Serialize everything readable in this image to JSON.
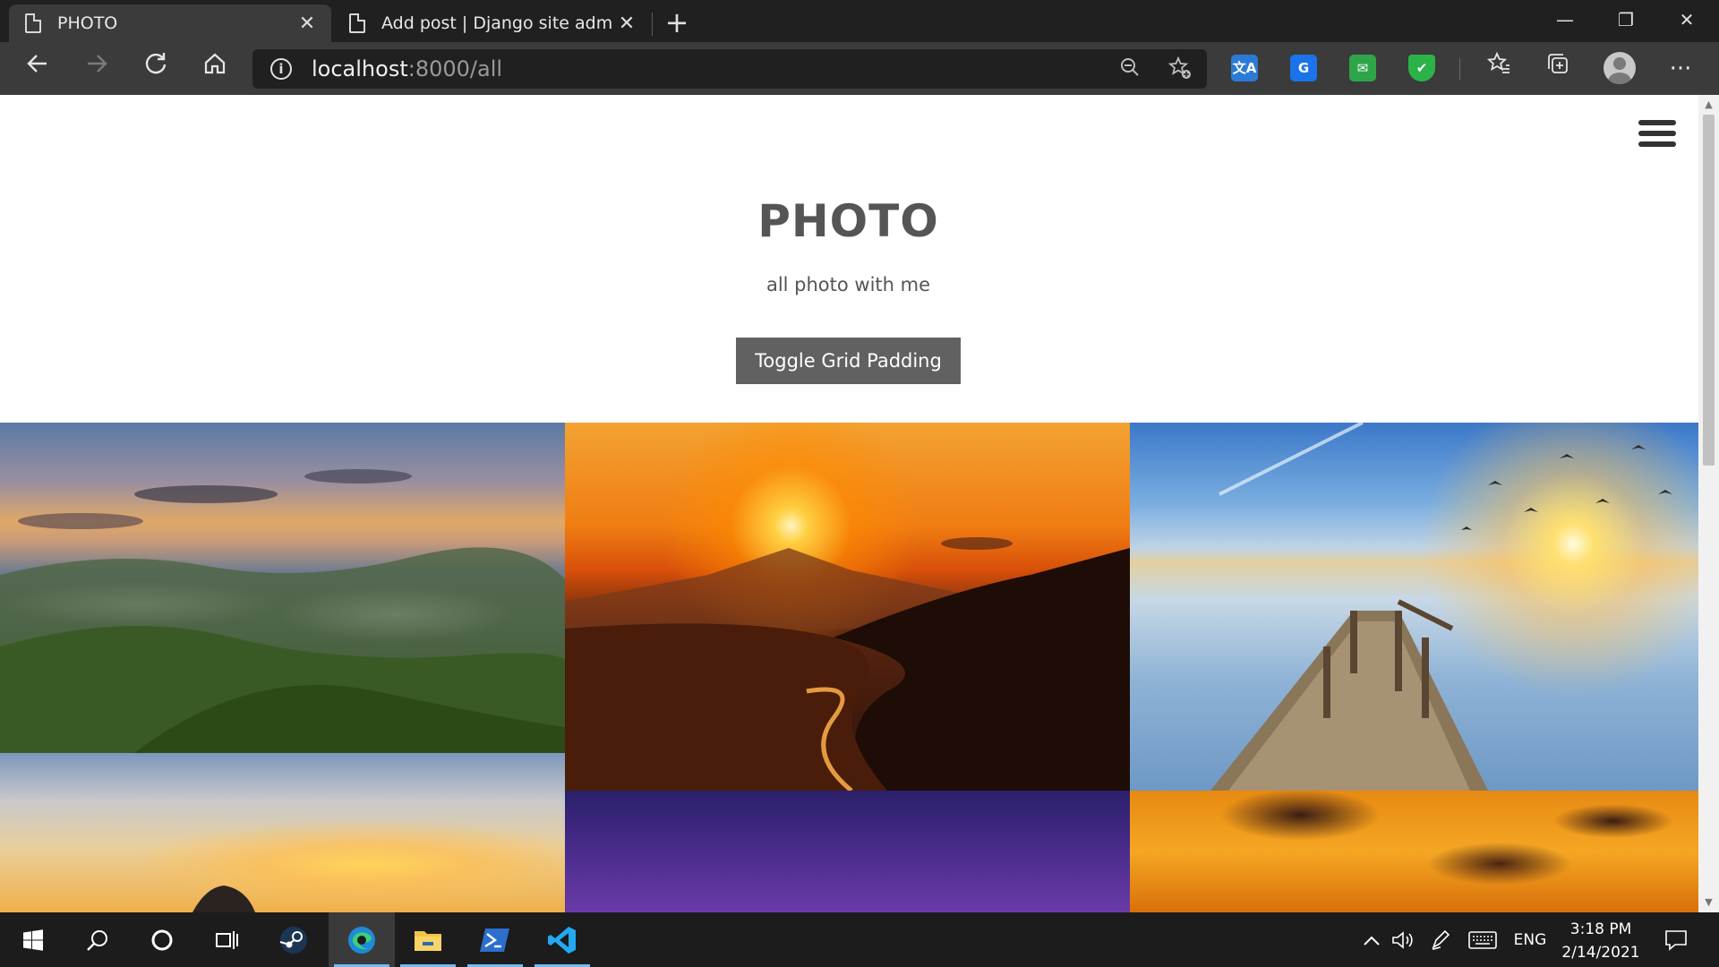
{
  "browser": {
    "tabs": [
      {
        "title": "PHOTO",
        "active": true
      },
      {
        "title": "Add post | Django site admin",
        "active": false
      }
    ],
    "new_tab_glyph": "+",
    "window_controls": {
      "minimize": "—",
      "restore": "❐",
      "close": "✕"
    },
    "address": {
      "host": "localhost",
      "rest": ":8000/all"
    },
    "icons": [
      "back-icon",
      "forward-icon",
      "refresh-icon",
      "home-icon",
      "info-icon",
      "zoom-out-icon",
      "add-favorite-icon",
      "translate-icon",
      "google-translate-icon",
      "mail-extension-icon",
      "shield-extension-icon",
      "favorites-icon",
      "collections-icon",
      "profile-avatar",
      "more-options-icon"
    ],
    "extensions": {
      "translate": "文A",
      "google_translate": "G",
      "mail": "✉",
      "shield": "✔"
    }
  },
  "page": {
    "title": "PHOTO",
    "subtitle": "all photo with me",
    "toggle_button": "Toggle Grid Padding",
    "photos": [
      {
        "name": "mountain-clouds-photo"
      },
      {
        "name": "sunset-beach-photo"
      },
      {
        "name": "pier-lake-photo"
      },
      {
        "name": "sunset-sky-photo"
      },
      {
        "name": "purple-night-sky-photo"
      },
      {
        "name": "orange-clouds-photo"
      }
    ]
  },
  "taskbar": {
    "apps": [
      "start-icon",
      "search-icon",
      "cortana-icon",
      "task-view-icon",
      "steam-icon",
      "edge-icon",
      "file-explorer-icon",
      "powershell-icon",
      "vscode-icon"
    ],
    "tray": {
      "language": "ENG",
      "time": "3:18 PM",
      "date": "2/14/2021"
    },
    "colors": {
      "accent": "#76b9ed"
    }
  }
}
